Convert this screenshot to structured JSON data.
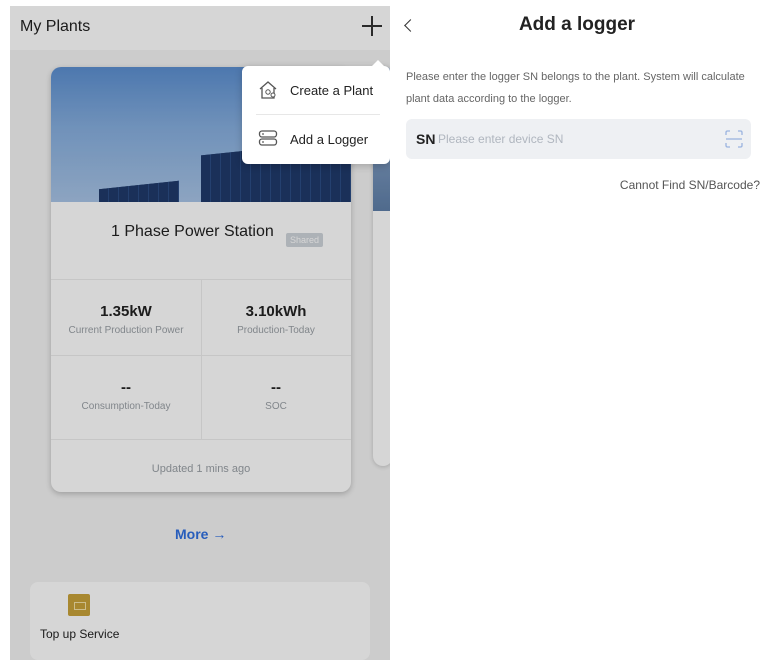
{
  "left": {
    "title": "My Plants",
    "plant_card": {
      "name": "1 Phase Power Station",
      "badge": "Shared",
      "metrics": [
        {
          "value": "1.35kW",
          "label": "Current Production Power"
        },
        {
          "value": "3.10kWh",
          "label": "Production-Today"
        },
        {
          "value": "--",
          "label": "Consumption-Today"
        },
        {
          "value": "--",
          "label": "SOC"
        }
      ],
      "updated": "Updated 1 mins ago"
    },
    "more_label": "More →",
    "service_label": "Top up Service",
    "popover": {
      "items": [
        {
          "label": "Create a Plant",
          "icon": "house-icon"
        },
        {
          "label": "Add a Logger",
          "icon": "logger-icon"
        }
      ]
    }
  },
  "right": {
    "title": "Add a logger",
    "description": "Please enter the logger SN belongs to the plant. System will calculate plant data according to the logger.",
    "sn_label": "SN",
    "sn_placeholder": "Please enter device SN",
    "cannot_find": "Cannot Find SN/Barcode?"
  },
  "colors": {
    "accent": "#2f6fe0",
    "service_icon": "#c9a23a"
  }
}
